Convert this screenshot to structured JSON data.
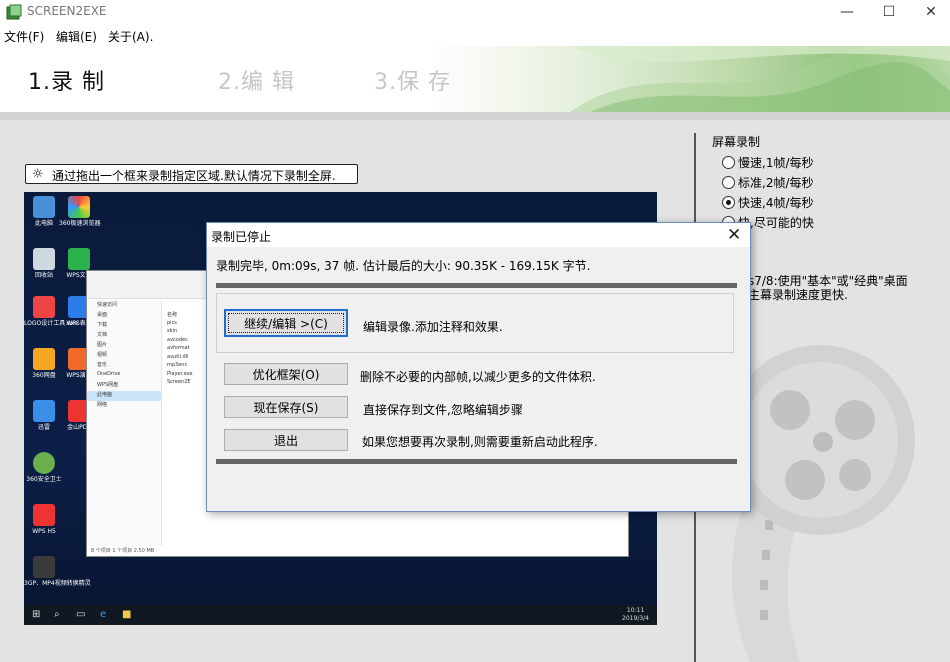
{
  "window": {
    "title": "SCREEN2EXE",
    "minimize": "—",
    "maximize": "☐",
    "close": "✕"
  },
  "menu": [
    "文件(F)",
    "编辑(E)",
    "关于(A)."
  ],
  "steps": [
    "1.录 制",
    "2.编 辑",
    "3.保 存"
  ],
  "hint": {
    "icon": "☼",
    "text": "通过拖出一个框来录制指定区域.默认情况下录制全屏."
  },
  "right_panel": {
    "title": "屏幕录制",
    "options": [
      {
        "label": "慢速,1帧/每秒",
        "selected": false
      },
      {
        "label": "标准,2帧/每秒",
        "selected": false
      },
      {
        "label": "快速,4帧/每秒",
        "selected": true
      },
      {
        "label": "快,尽可能的快",
        "selected": false
      }
    ],
    "note": "s7/8:使用\"基本\"或\"经典\"桌面主幕录制速度更快."
  },
  "desktop": {
    "icons": [
      "此电脑",
      "360极速浏览器",
      "回收站",
      "WPS文字",
      "LOGO设计工具.exe",
      "WPS表格",
      "360网盘",
      "WPS演示",
      "迅雷",
      "金山PDF",
      "360安全卫士",
      "WPS H5",
      "3GP、MP4视频转换精灵"
    ],
    "explorer_nav": [
      "快速访问",
      "桌面",
      "下载",
      "文档",
      "图片",
      "视频",
      "音乐",
      "OneDrive",
      "WPS网盘",
      "此电脑",
      "网络"
    ],
    "explorer_files": [
      "名称",
      "pics",
      "skin",
      "avcodec",
      "avformat",
      "avutil.dll",
      "mp3enc",
      "Player.exe",
      "Screen2E"
    ],
    "explorer_status": "8 个项目   1 个项目  2.50 MB",
    "clock_time": "10:11",
    "clock_date": "2019/3/4"
  },
  "dialog": {
    "title": "录制已停止",
    "close": "✕",
    "info": "录制完毕, 0m:09s, 37 帧. 估计最后的大小: 90.35K - 169.15K 字节.",
    "buttons": [
      {
        "label": "继续/编辑 >(C)",
        "desc": "编辑录像.添加注释和效果."
      },
      {
        "label": "优化框架(O)",
        "desc": "删除不必要的内部帧,以减少更多的文件体积."
      },
      {
        "label": "现在保存(S)",
        "desc": "直接保存到文件,忽略编辑步骤"
      },
      {
        "label": "退出",
        "desc": "如果您想要再次录制,则需要重新启动此程序."
      }
    ]
  },
  "colors": {
    "header_green": "#8cc17a",
    "main_gray": "#e3e3e3",
    "dialog_bg": "#f0f0f0",
    "focus_blue": "#1f6fd2"
  }
}
